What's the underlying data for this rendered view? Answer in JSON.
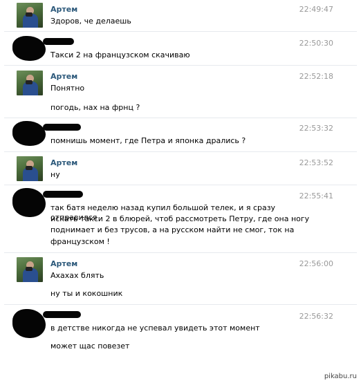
{
  "conversation": {
    "messages": [
      {
        "author": "Артем",
        "time": "22:49:47",
        "lines": [
          "Здоров, че делаешь"
        ]
      },
      {
        "author": "",
        "time": "22:50:30",
        "lines": [
          "Такси 2 на французском скачиваю"
        ]
      },
      {
        "author": "Артем",
        "time": "22:52:18",
        "lines": [
          "Понятно",
          "погодь, нах на фрнц ?"
        ]
      },
      {
        "author": "",
        "time": "22:53:32",
        "lines": [
          "помнишь момент, где Петра и японка дрались ?"
        ]
      },
      {
        "author": "Артем",
        "time": "22:53:52",
        "lines": [
          "ну"
        ]
      },
      {
        "author": "",
        "time": "22:55:41",
        "lines": [
          "так батя неделю назад купил большой телек, и я сразу отправился",
          "искать такси 2 в блюрей, чтоб рассмотреть Петру, где она ногу",
          "поднимает и без трусов, а на русском найти не смог, ток на",
          "французском !"
        ]
      },
      {
        "author": "Артем",
        "time": "22:56:00",
        "lines": [
          "Ахахах блять",
          "ну ты и кокошник"
        ]
      },
      {
        "author": "",
        "time": "22:56:32",
        "lines": [
          "в детстве никогда не успевал увидеть этот момент",
          "может щас повезет"
        ]
      }
    ]
  },
  "watermark": "pikabu.ru",
  "colors": {
    "author_name": "#2b587a",
    "timestamp": "#999999",
    "separator": "#e6e9ee"
  }
}
